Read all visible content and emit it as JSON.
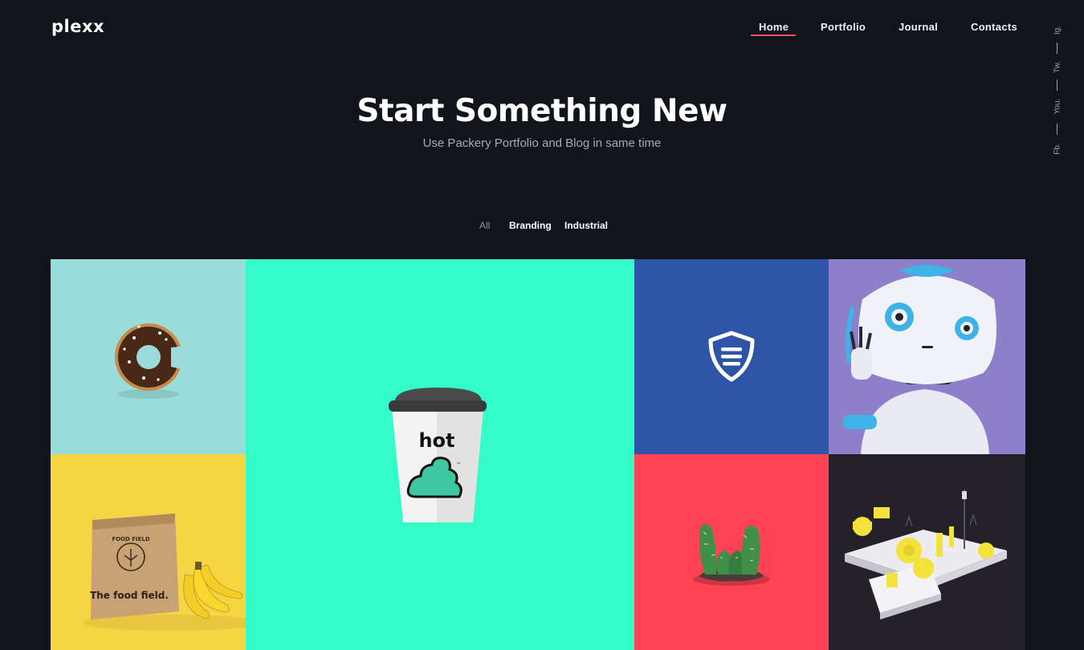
{
  "header": {
    "logo": "plexx",
    "nav": [
      {
        "label": "Home",
        "active": true
      },
      {
        "label": "Portfolio",
        "active": false
      },
      {
        "label": "Journal",
        "active": false
      },
      {
        "label": "Contacts",
        "active": false
      }
    ],
    "accent_color": "#f0506e"
  },
  "social": [
    "Ig.",
    "Tw.",
    "You.",
    "Fb."
  ],
  "hero": {
    "title": "Start Something New",
    "subtitle": "Use Packery Portfolio and Blog in same time"
  },
  "filters": [
    {
      "label": "All",
      "active": true
    },
    {
      "label": "Branding",
      "active": false
    },
    {
      "label": "Industrial",
      "active": false
    }
  ],
  "portfolio": {
    "tiles": [
      {
        "name": "donut",
        "background": "#9adcd9",
        "icon": "donut-image"
      },
      {
        "name": "food-field-bag",
        "background": "#f6d544",
        "icon": "paper-bag-image",
        "product_text": "The food field.",
        "badge_text": "FOOD FIELD"
      },
      {
        "name": "hot-cup",
        "background": "#33fcc8",
        "icon": "coffee-cup-image",
        "product_text": "hot",
        "tm": "™"
      },
      {
        "name": "shield",
        "background": "#2e54a8",
        "icon": "shield-icon"
      },
      {
        "name": "robot",
        "background": "#8d7fca",
        "icon": "robot-image"
      },
      {
        "name": "cactus",
        "background": "#ff4254",
        "icon": "cactus-image"
      },
      {
        "name": "industrial-model",
        "background": "#25212a",
        "icon": "industrial-model-image"
      }
    ]
  }
}
